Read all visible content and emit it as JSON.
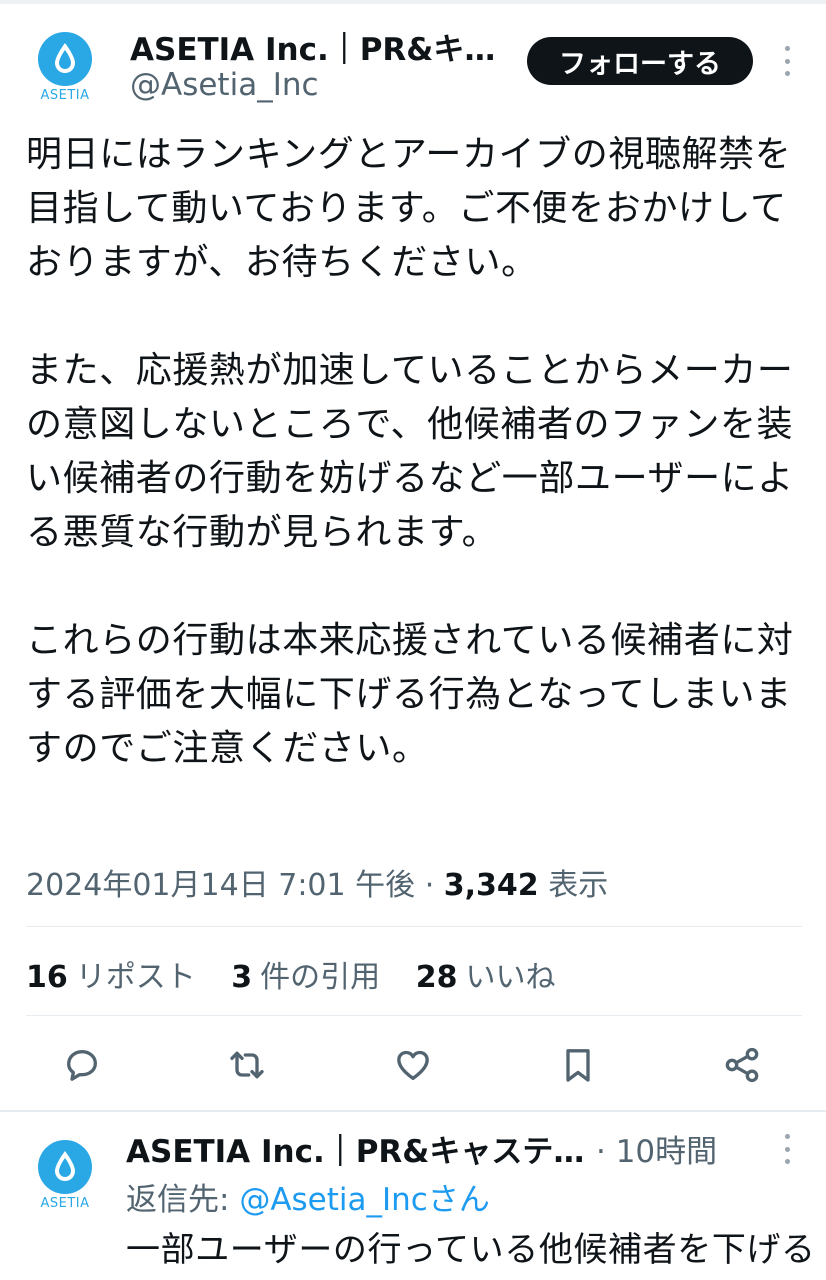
{
  "tweet": {
    "author_name": "ASETIA Inc.｜PR&キ…",
    "handle": "@Asetia_Inc",
    "follow_label": "フォローする",
    "logo_text": "ASETIA",
    "paragraphs": [
      "明日にはランキングとアーカイブの視聴解禁を目指して動いております。ご不便をおかけしておりますが、お待ちください。",
      "また、応援熱が加速していることからメーカーの意図しないところで、他候補者のファンを装い候補者の行動を妨げるなど一部ユーザーによる悪質な行動が見られます。",
      "これらの行動は本来応援されている候補者に対する評価を大幅に下げる行為となってしまいますのでご注意ください。"
    ],
    "timestamp": "2024年01月14日 7:01 午後",
    "views_count": "3,342",
    "views_label": "表示",
    "stats": {
      "reposts_count": "16",
      "reposts_label": "リポスト",
      "quotes_count": "3",
      "quotes_label": "件の引用",
      "likes_count": "28",
      "likes_label": "いいね"
    },
    "actions": [
      "reply-icon",
      "retweet-icon",
      "like-icon",
      "bookmark-icon",
      "share-icon"
    ]
  },
  "reply": {
    "author_name": "ASETIA Inc.｜PR&キャステ…",
    "time": "· 10時間",
    "reply_to_label": "返信先:",
    "reply_to_mention": "@Asetia_Incさん",
    "text": "一部ユーザーの行っている他候補者を下げる",
    "logo_text": "ASETIA"
  },
  "colors": {
    "text": "#0f1419",
    "secondary": "#536471",
    "link": "#1d9bf0",
    "brand": "#2aa8e6",
    "follow_bg": "#0f1419"
  }
}
